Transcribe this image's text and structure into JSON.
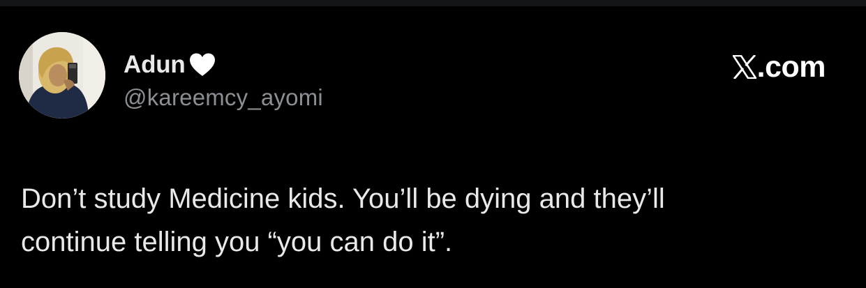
{
  "author": {
    "display_name": "Adun",
    "name_emoji_icon": "white-heart-icon",
    "handle": "@kareemcy_ayomi",
    "avatar_icon": "profile-photo"
  },
  "brand": {
    "logo_icon": "x-logo-icon",
    "suffix": ".com"
  },
  "tweet": {
    "lines": [
      "Don’t study Medicine kids. You’ll be dying and they’ll",
      "continue telling you “you can do it”."
    ]
  },
  "colors": {
    "background": "#000000",
    "top_strip": "#121416",
    "primary_text": "#e7e9ea",
    "secondary_text": "#8b8f94",
    "brand": "#ffffff"
  }
}
